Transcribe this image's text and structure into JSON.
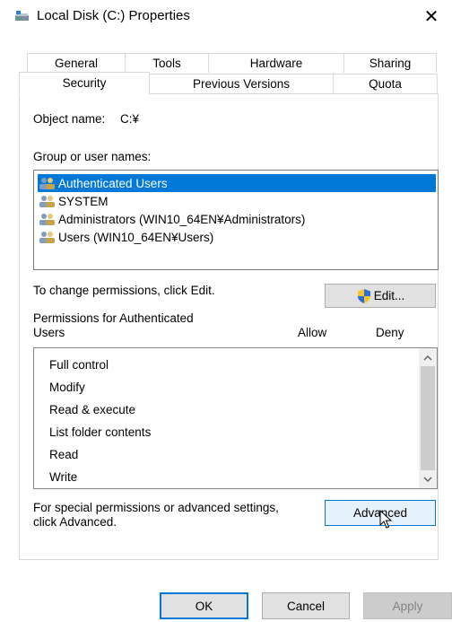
{
  "window": {
    "title": "Local Disk (C:) Properties",
    "close_glyph": "✕"
  },
  "tabs_row1": [
    "General",
    "Tools",
    "Hardware",
    "Sharing"
  ],
  "tabs_row2": [
    "Security",
    "Previous Versions",
    "Quota"
  ],
  "active_tab": "Security",
  "object_name": {
    "label": "Object name:",
    "value": "C:¥"
  },
  "group_users": {
    "label": "Group or user names:",
    "items": [
      "Authenticated Users",
      "SYSTEM",
      "Administrators (WIN10_64EN¥Administrators)",
      "Users (WIN10_64EN¥Users)"
    ],
    "selected_index": 0
  },
  "change_perm": {
    "text": "To change permissions, click Edit.",
    "edit_button": "Edit..."
  },
  "permissions": {
    "header_line1": "Permissions for Authenticated",
    "header_line2": "Users",
    "allow_label": "Allow",
    "deny_label": "Deny",
    "items": [
      "Full control",
      "Modify",
      "Read & execute",
      "List folder contents",
      "Read",
      "Write"
    ]
  },
  "advanced": {
    "text_line1": "For special permissions or advanced settings,",
    "text_line2": "click Advanced.",
    "button": "Advanced"
  },
  "footer": {
    "ok": "OK",
    "cancel": "Cancel",
    "apply": "Apply"
  },
  "colors": {
    "selection": "#0078d7",
    "button_face": "#e1e1e1",
    "focus_border": "#0078d7"
  },
  "icons": {
    "title": "drive-icon",
    "users": "user-group-icon",
    "edit": "uac-shield-icon",
    "cursor": "mouse-pointer-icon"
  }
}
